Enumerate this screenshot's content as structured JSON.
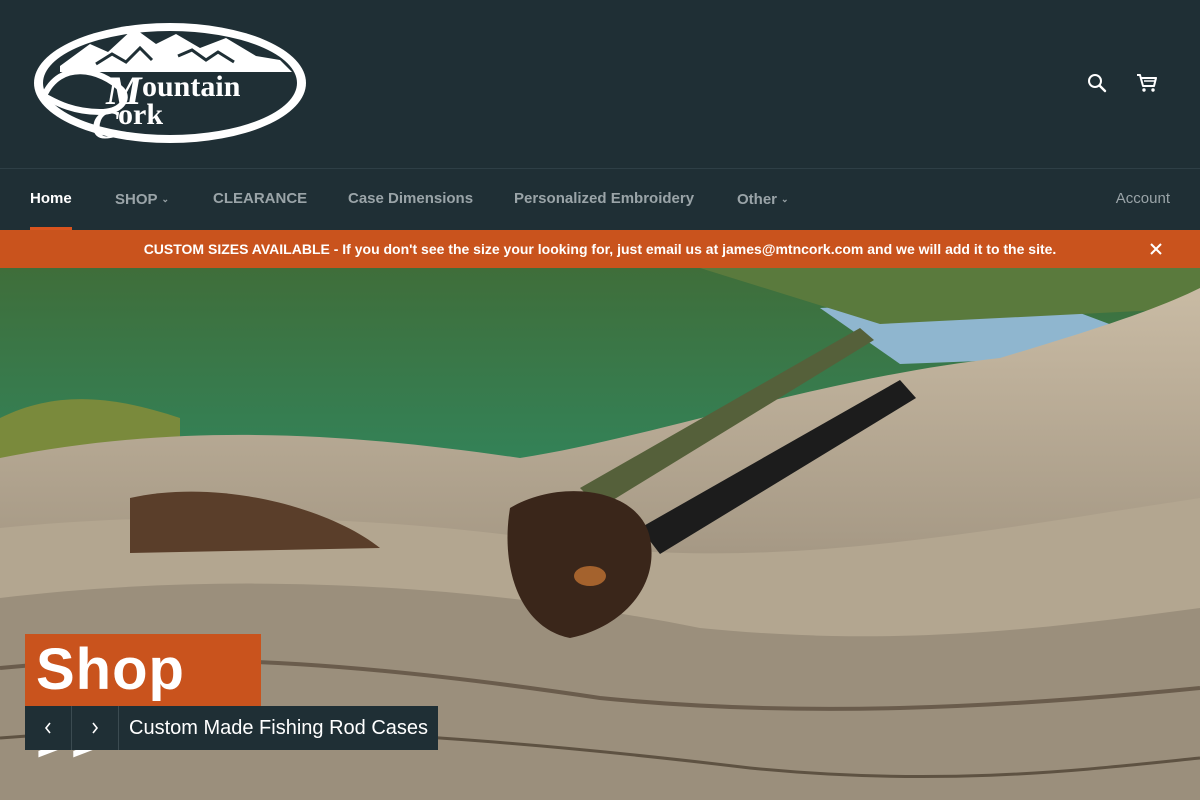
{
  "brand": {
    "logo_line1": "Mountain",
    "logo_line2": "Cork"
  },
  "header": {
    "icons": [
      "search-icon",
      "cart-icon"
    ]
  },
  "nav": {
    "items": [
      {
        "label": "Home",
        "active": true
      },
      {
        "label": "SHOP",
        "dropdown": true
      },
      {
        "label": "CLEARANCE"
      },
      {
        "label": "Case Dimensions"
      },
      {
        "label": "Personalized Embroidery"
      },
      {
        "label": "Other",
        "dropdown": true
      }
    ],
    "account_label": "Account"
  },
  "announcement": {
    "text": "CUSTOM SIZES AVAILABLE - If you don't see the size your looking for, just email us at james@mtncork.com and we will add it to the site."
  },
  "hero": {
    "cta_label": "Shop >>",
    "caption": "Custom Made Fishing Rod Cases",
    "prev_icon": "chevron-left-icon",
    "next_icon": "chevron-right-icon"
  },
  "colors": {
    "header_bg": "#1f2f35",
    "accent": "#c9531d",
    "text_light": "#ffffff",
    "nav_text": "#9aa4a8"
  }
}
